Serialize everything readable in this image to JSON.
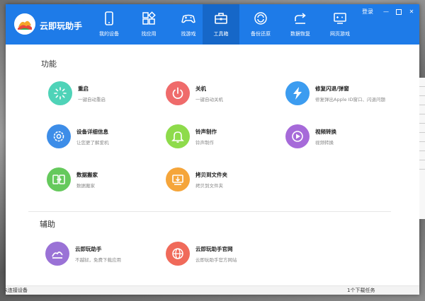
{
  "app": {
    "title": "云即玩助手"
  },
  "nav": [
    {
      "label": "我的设备",
      "icon": "phone-icon"
    },
    {
      "label": "找应用",
      "icon": "apps-icon"
    },
    {
      "label": "找游戏",
      "icon": "gamepad-icon"
    },
    {
      "label": "工具箱",
      "icon": "toolbox-icon",
      "active": true
    },
    {
      "label": "备份还原",
      "icon": "backup-icon"
    },
    {
      "label": "数据恢复",
      "icon": "restore-icon"
    },
    {
      "label": "网页游戏",
      "icon": "web-game-icon"
    }
  ],
  "window_controls": {
    "login": "登录",
    "minimize": "—",
    "close": "✕"
  },
  "sections": {
    "functions": "功能",
    "auxiliary": "辅助"
  },
  "tools": [
    {
      "title": "重启",
      "desc": "一键自动重启",
      "icon": "restart-icon",
      "color": "#4fd3b8"
    },
    {
      "title": "关机",
      "desc": "一键自动关机",
      "icon": "power-icon",
      "color": "#ef6b6b"
    },
    {
      "title": "修复闪退/弹窗",
      "desc": "修复弹出Apple ID窗口、闪退问题",
      "icon": "lightning-icon",
      "color": "#3c9cf0"
    },
    {
      "title": "设备详细信息",
      "desc": "让您更了解爱机",
      "icon": "settings-gear-icon",
      "color": "#3d8de8"
    },
    {
      "title": "铃声制作",
      "desc": "铃声制作",
      "icon": "bell-icon",
      "color": "#8edb4b"
    },
    {
      "title": "视频转换",
      "desc": "视频转换",
      "icon": "video-icon",
      "color": "#a66ad9"
    },
    {
      "title": "数据搬家",
      "desc": "数据搬家",
      "icon": "transfer-icon",
      "color": "#65c95c"
    },
    {
      "title": "拷贝到文件夹",
      "desc": "拷贝到文件夹",
      "icon": "folder-copy-icon",
      "color": "#f5a53a"
    }
  ],
  "aux": [
    {
      "title": "云即玩助手",
      "desc": "不越狱，免费下载应用",
      "icon": "cloud-logo-icon",
      "color": "#9a72d6"
    },
    {
      "title": "云即玩助手官网",
      "desc": "云即玩助手官方网站",
      "icon": "globe-icon",
      "color": "#f06a5a"
    }
  ],
  "status": {
    "left": "未连接设备",
    "right": "1个下载任务"
  }
}
